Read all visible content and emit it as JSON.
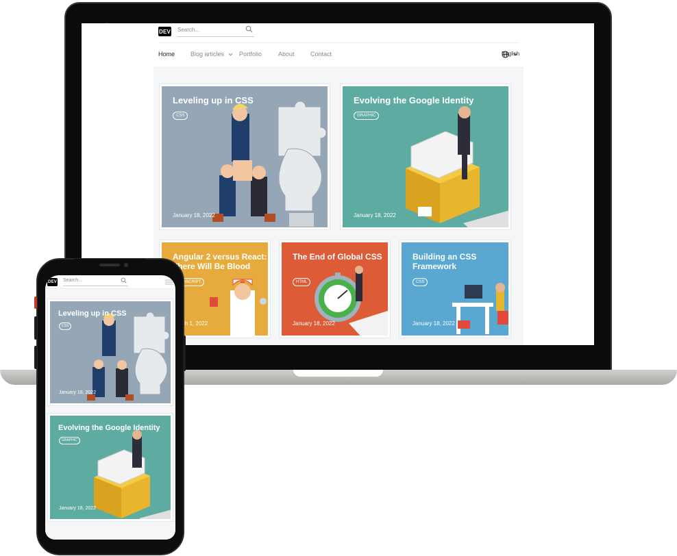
{
  "site": {
    "logo": "DEV",
    "search_placeholder": "Search...",
    "nav": {
      "home": "Home",
      "blog": "Blog articles",
      "portfolio": "Portfolio",
      "about": "About",
      "contact": "Contact"
    },
    "language": "English"
  },
  "desktop_cards": [
    {
      "title": "Leveling up in CSS",
      "tag": "CSS",
      "date": "January 18, 2022",
      "color": "#95a7b6"
    },
    {
      "title": "Evolving the Google Identity",
      "tag": "GRAPHIC",
      "date": "January 18, 2022",
      "color": "#5eaca1"
    },
    {
      "title": "Angular 2 versus React: There Will Be Blood",
      "tag": "JAVASCRIPT",
      "date": "March 1, 2022",
      "color": "#e6ab3c"
    },
    {
      "title": "The End of Global CSS",
      "tag": "HTML",
      "date": "January 18, 2022",
      "color": "#dd5b37"
    },
    {
      "title": "Building an CSS Framework",
      "tag": "CSS",
      "date": "January 18, 2022",
      "color": "#5aa8d1"
    }
  ],
  "mobile_cards": [
    {
      "title": "Leveling up in CSS",
      "tag": "CSS",
      "date": "January 18, 2022"
    },
    {
      "title": "Evolving the Google Identity",
      "tag": "GRAPHIC",
      "date": "January 18, 2022"
    }
  ],
  "icons": [
    "search-icon",
    "chevron-down-icon",
    "globe-icon",
    "hamburger-menu-icon"
  ]
}
